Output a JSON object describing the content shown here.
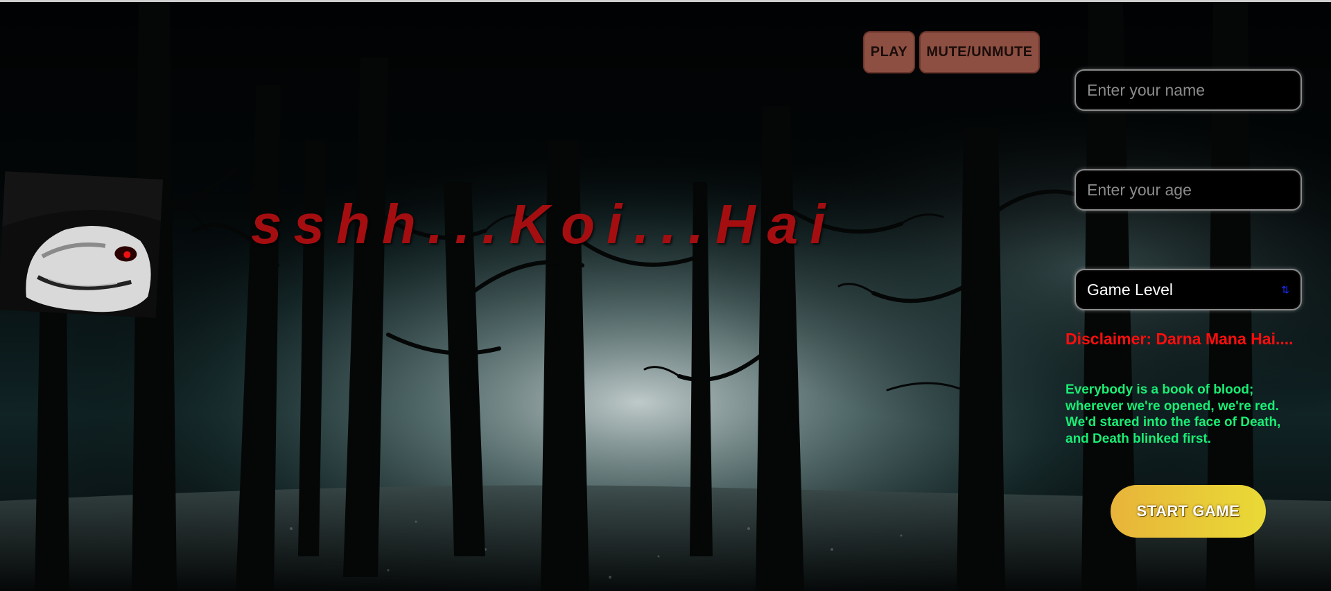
{
  "title": "sshh...Koi...Hai",
  "toolbar": {
    "play_label": "PLAY",
    "mute_label": "MUTE/UNMUTE"
  },
  "form": {
    "name_placeholder": "Enter your name",
    "name_value": "",
    "age_placeholder": "Enter your age",
    "age_value": "",
    "level_selected": "Game Level",
    "start_label": "START GAME"
  },
  "disclaimer": "Disclaimer: Darna Mana Hai....",
  "quote": [
    "Everybody is a book of blood;",
    "wherever we're opened, we're red.",
    "We'd stared into the face of Death,",
    "and Death blinked first."
  ],
  "colors": {
    "title": "#a50e10",
    "button_brown": "#8e4f43",
    "disclaimer": "#ff0d0d",
    "quote": "#19ee74",
    "start_gradient_from": "#e8b43a",
    "start_gradient_to": "#e9da36"
  },
  "icons": {
    "select_arrow": "chevron-updown-icon",
    "ghost": "ghost-face-image"
  }
}
